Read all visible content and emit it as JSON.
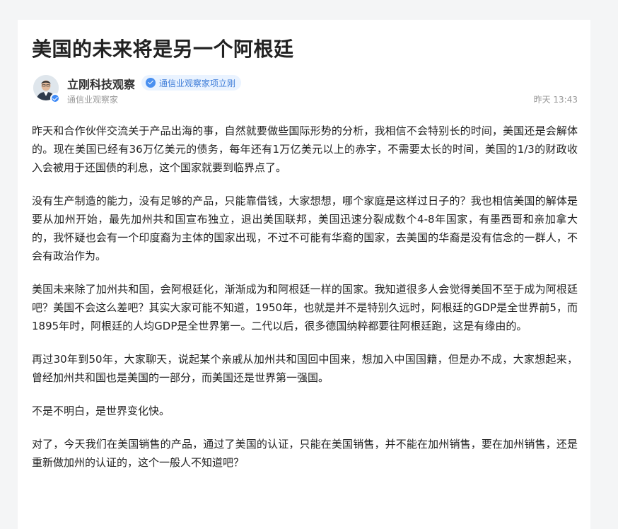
{
  "article": {
    "title": "美国的未来将是另一个阿根廷",
    "author": {
      "name": "立刚科技观察",
      "badge": "通信业观察家项立刚",
      "subtitle": "通信业观察家",
      "timestamp": "昨天 13:43"
    },
    "paragraphs": [
      "昨天和合作伙伴交流关于产品出海的事，自然就要做些国际形势的分析，我相信不会特别长的时间，美国还是会解体的。现在美国已经有36万亿美元的债务，每年还有1万亿美元以上的赤字，不需要太长的时间，美国的1/3的财政收入会被用于还国债的利息，这个国家就要到临界点了。",
      "没有生产制造的能力，没有足够的产品，只能靠借钱，大家想想，哪个家庭是这样过日子的？我也相信美国的解体是要从加州开始，最先加州共和国宣布独立，退出美国联邦，美国迅速分裂成数个4-8年国家，有墨西哥和亲加拿大的，我怀疑也会有一个印度裔为主体的国家出现，不过不可能有华裔的国家，去美国的华裔是没有信念的一群人，不会有政治作为。",
      "美国未来除了加州共和国，会阿根廷化，渐渐成为和阿根廷一样的国家。我知道很多人会觉得美国不至于成为阿根廷吧？美国不会这么差吧？其实大家可能不知道，1950年，也就是并不是特别久远时，阿根廷的GDP是全世界前5，而1895年时，阿根廷的人均GDP是全世界第一。二代以后，很多德国纳粹都要往阿根廷跑，这是有缘由的。",
      "再过30年到50年，大家聊天，说起某个亲戚从加州共和国回中国来，想加入中国国籍，但是办不成，大家想起来，曾经加州共和国也是美国的一部分，而美国还是世界第一强国。",
      "不是不明白，是世界变化快。",
      "对了，今天我们在美国销售的产品，通过了美国的认证，只能在美国销售，并不能在加州销售，要在加州销售，还是重新做加州的认证的，这个一般人不知道吧？"
    ]
  },
  "icons": {
    "avatar": "person-avatar",
    "verified": "verified-check-icon"
  },
  "colors": {
    "accent": "#3d8af7",
    "badge_bg": "#eaf3ff",
    "badge_text": "#3d7cd8",
    "text": "#222222",
    "meta": "#999999"
  }
}
